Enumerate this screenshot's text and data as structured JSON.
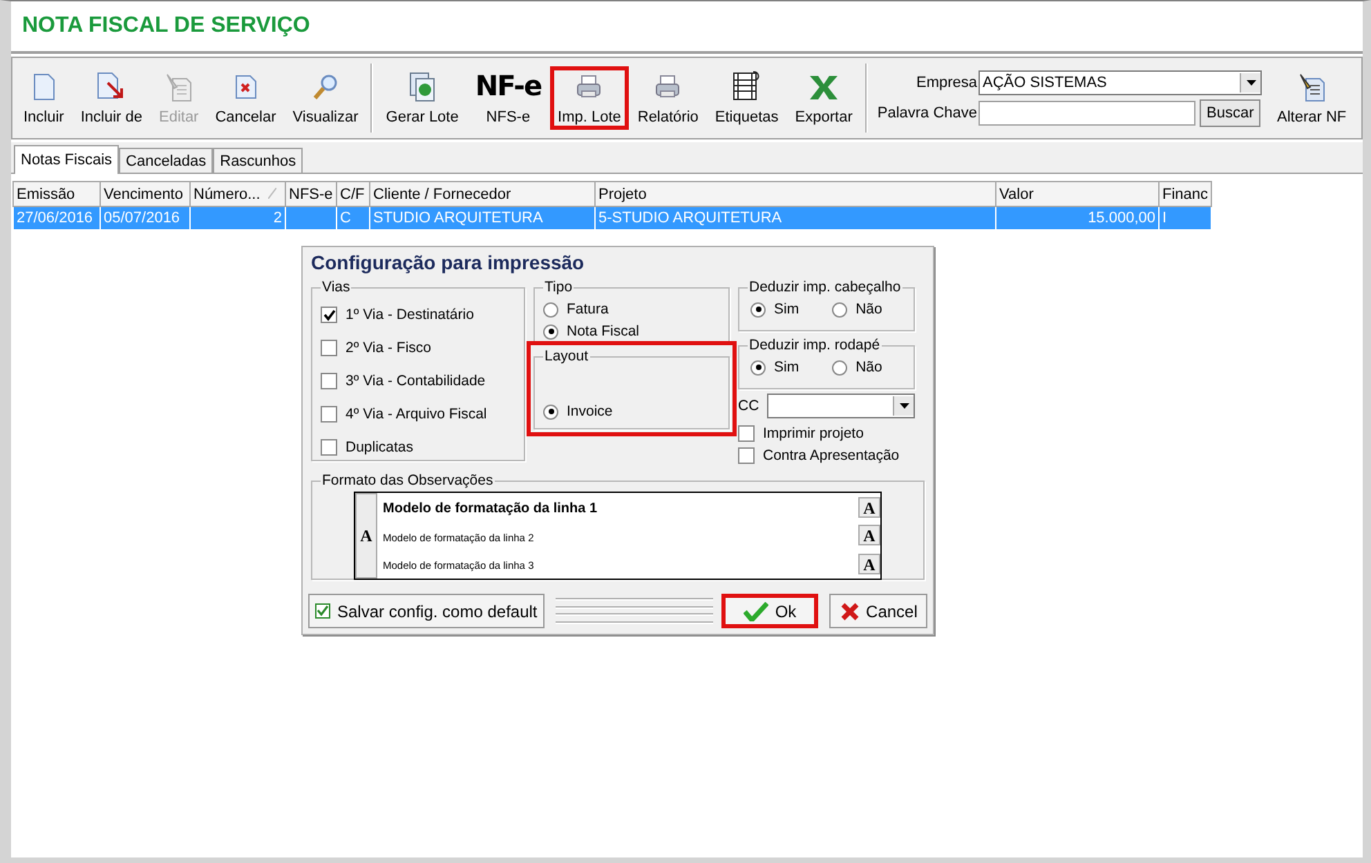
{
  "window": {
    "title": "NOTA FISCAL DE SERVIÇO"
  },
  "toolbar": {
    "groups": [
      {
        "buttons": [
          {
            "label": "Incluir",
            "disabled": false,
            "highlighted": false
          },
          {
            "label": "Incluir de",
            "disabled": false,
            "highlighted": false
          },
          {
            "label": "Editar",
            "disabled": true,
            "highlighted": false
          },
          {
            "label": "Cancelar",
            "disabled": false,
            "highlighted": false
          },
          {
            "label": "Visualizar",
            "disabled": false,
            "highlighted": false
          }
        ]
      },
      {
        "buttons": [
          {
            "label": "Gerar Lote",
            "disabled": false,
            "highlighted": false
          },
          {
            "label": "NFS-e",
            "logo": "NF-e",
            "disabled": false,
            "highlighted": false
          },
          {
            "label": "Imp. Lote",
            "disabled": false,
            "highlighted": true
          },
          {
            "label": "Relatório",
            "disabled": false,
            "highlighted": false
          },
          {
            "label": "Etiquetas",
            "disabled": false,
            "highlighted": false
          },
          {
            "label": "Exportar",
            "disabled": false,
            "highlighted": false
          }
        ]
      }
    ],
    "filter": {
      "company_label": "Empresa",
      "company": "AÇÃO SISTEMAS",
      "keyword_label": "Palavra Chave",
      "search_button": "Buscar"
    },
    "extra_button": {
      "label": "Alterar NF"
    }
  },
  "tabs": [
    {
      "label": "Notas Fiscais",
      "selected": true
    },
    {
      "label": "Canceladas",
      "selected": false
    },
    {
      "label": "Rascunhos",
      "selected": false
    }
  ],
  "table": {
    "columns": [
      {
        "label": "Emissão"
      },
      {
        "label": "Vencimento"
      },
      {
        "label": "Número...",
        "numeric": true,
        "sorted": true
      },
      {
        "label": "NFS-e"
      },
      {
        "label": "C/F"
      },
      {
        "label": "Cliente / Fornecedor"
      },
      {
        "label": "Projeto"
      },
      {
        "label": "Valor",
        "numeric": true
      },
      {
        "label": "Financ"
      }
    ],
    "rows": [
      {
        "selected": true,
        "cells": [
          "27/06/2016",
          "05/07/2016",
          "2",
          "",
          "C",
          "STUDIO ARQUITETURA",
          "5-STUDIO ARQUITETURA",
          "15.000,00",
          "I"
        ]
      }
    ]
  },
  "dialog": {
    "title": "Configuração para impressão",
    "vias": {
      "label": "Vias",
      "items": [
        {
          "label": "1º Via - Destinatário",
          "checked": true
        },
        {
          "label": "2º Via - Fisco",
          "checked": false
        },
        {
          "label": "3º Via - Contabilidade",
          "checked": false
        },
        {
          "label": "4º Via - Arquivo Fiscal",
          "checked": false
        },
        {
          "label": "Duplicatas",
          "checked": false
        }
      ]
    },
    "tipo": {
      "label": "Tipo",
      "options": [
        {
          "label": "Fatura",
          "selected": false
        },
        {
          "label": "Nota Fiscal",
          "selected": true
        }
      ]
    },
    "layout": {
      "label": "Layout",
      "highlighted": true,
      "options": [
        {
          "label": "Invoice",
          "selected": true
        }
      ]
    },
    "header_deduction": {
      "label": "Deduzir imp. cabeçalho",
      "options": [
        {
          "label": "Sim",
          "selected": true
        },
        {
          "label": "Não",
          "selected": false
        }
      ]
    },
    "footer_deduction": {
      "label": "Deduzir imp. rodapé",
      "options": [
        {
          "label": "Sim",
          "selected": true
        },
        {
          "label": "Não",
          "selected": false
        }
      ]
    },
    "cc": {
      "label": "CC"
    },
    "options": [
      {
        "label": "Imprimir projeto",
        "checked": false
      },
      {
        "label": "Contra Apresentação",
        "checked": false
      }
    ],
    "observations": {
      "label": "Formato das Observações",
      "font_button": "A",
      "line_font_buttons": [
        "A",
        "A",
        "A"
      ],
      "lines": [
        {
          "text": "Modelo de formatação da linha 1",
          "bold": true
        },
        {
          "text": "Modelo de formatação da linha 2",
          "bold": false
        },
        {
          "text": "Modelo de formatação da linha 3",
          "bold": false
        }
      ]
    },
    "buttons": [
      {
        "label": "Salvar config. como default",
        "kind": "save",
        "highlighted": false
      },
      {
        "label": "Ok",
        "kind": "ok",
        "highlighted": true
      },
      {
        "label": "Cancel",
        "kind": "cancel",
        "highlighted": false
      }
    ]
  }
}
